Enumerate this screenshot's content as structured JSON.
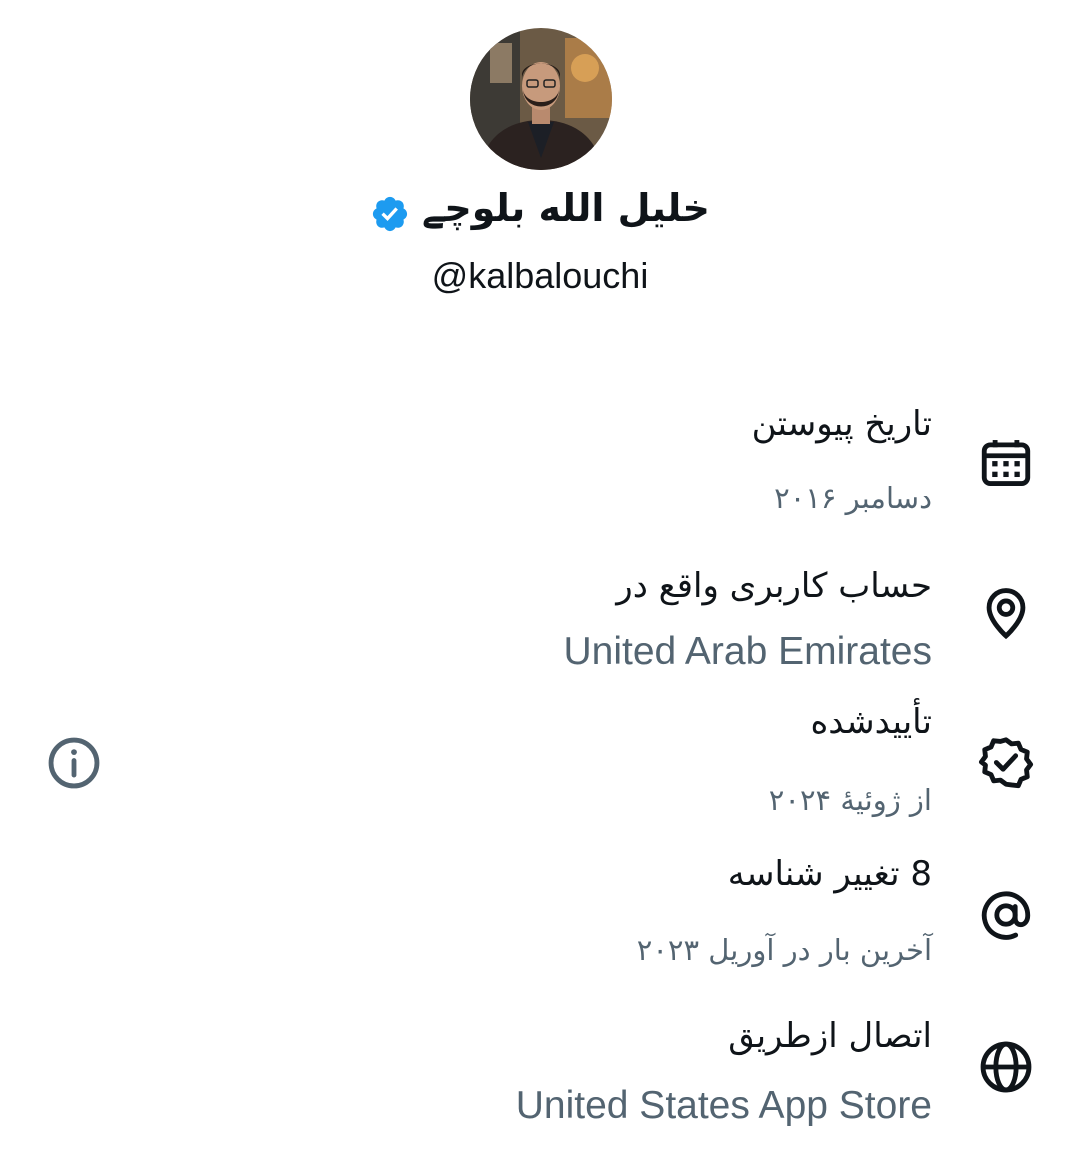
{
  "profile": {
    "display_name": "خلیل الله بلوچے",
    "handle": "@kalbalouchi",
    "verified_badge_icon": "verified-badge-icon",
    "badge_color": "#1d9bf0"
  },
  "about": {
    "items": [
      {
        "icon": "calendar-icon",
        "label": "تاریخ پیوستن",
        "value": "دسامبر ۲۰۱۶"
      },
      {
        "icon": "location-pin-icon",
        "label": "حساب کاربری واقع در",
        "value": "United Arab Emirates"
      },
      {
        "icon": "verified-check-icon",
        "label": "تأییدشده",
        "value": "از ژوئیهٔ ۲۰۲۴"
      },
      {
        "icon": "at-sign-icon",
        "label": "8 تغییر شناسه",
        "value": "آخرین بار در آوریل ۲۰۲۳"
      },
      {
        "icon": "globe-icon",
        "label": "اتصال ازطریق",
        "value": "United States App Store"
      }
    ],
    "info_icon": "info-icon"
  },
  "colors": {
    "text_primary": "#0f1419",
    "text_secondary": "#536471",
    "icon": "#0f1419",
    "info_icon": "#536471"
  }
}
